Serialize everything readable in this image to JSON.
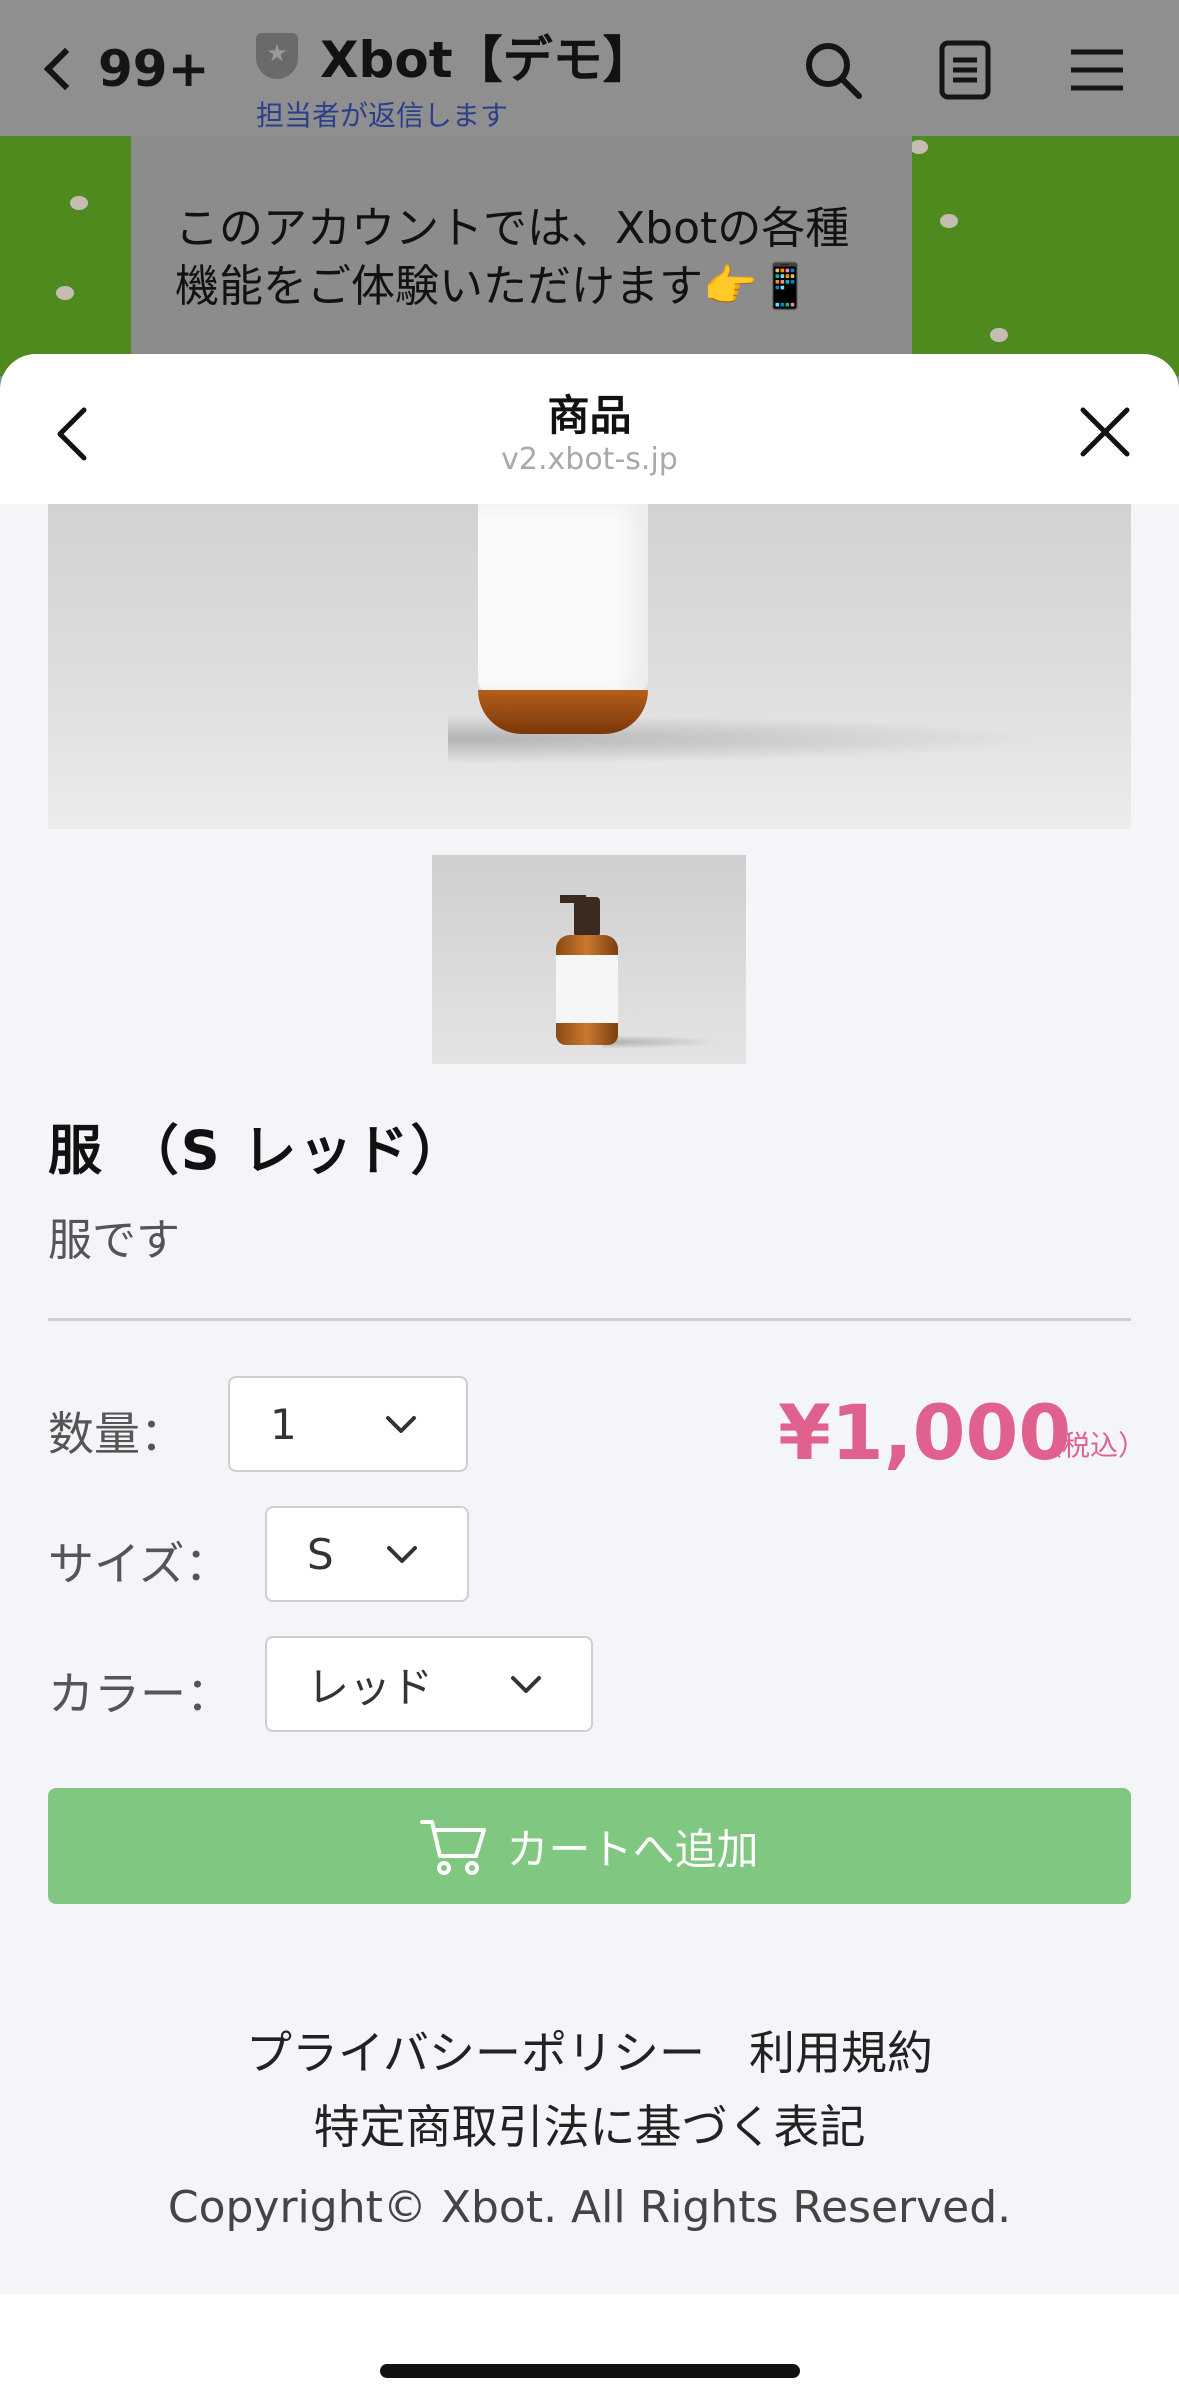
{
  "chat_header": {
    "unread_count": "99+",
    "account_name": "Xbot【デモ】",
    "account_status": "担当者が返信します"
  },
  "chat_bubble": {
    "line1": "このアカウントでは、Xbotの各種",
    "line2": "機能をご体験いただけます👉📱"
  },
  "sheet": {
    "title": "商品",
    "url": "v2.xbot-s.jp"
  },
  "product": {
    "title": "服 （S レッド）",
    "description": "服です",
    "price": "¥1,000",
    "tax_note": "（税込）"
  },
  "options": {
    "quantity_label": "数量：",
    "quantity_value": "1",
    "size_label": "サイズ：",
    "size_value": "S",
    "color_label": "カラー：",
    "color_value": "レッド"
  },
  "cart_button": {
    "label": "カートへ追加"
  },
  "footer": {
    "privacy": "プライバシーポリシー",
    "terms": "利用規約",
    "tokushoho": "特定商取引法に基づく表記",
    "copyright": "Copyright© Xbot. All Rights Reserved."
  },
  "colors": {
    "price": "#e0608e",
    "cart_button": "#80c882",
    "status_link": "#2c3f8a"
  },
  "icons": [
    "back-chevron-icon",
    "shield-star-icon",
    "search-icon",
    "notes-icon",
    "menu-icon",
    "close-icon",
    "chevron-down-icon",
    "cart-icon"
  ]
}
